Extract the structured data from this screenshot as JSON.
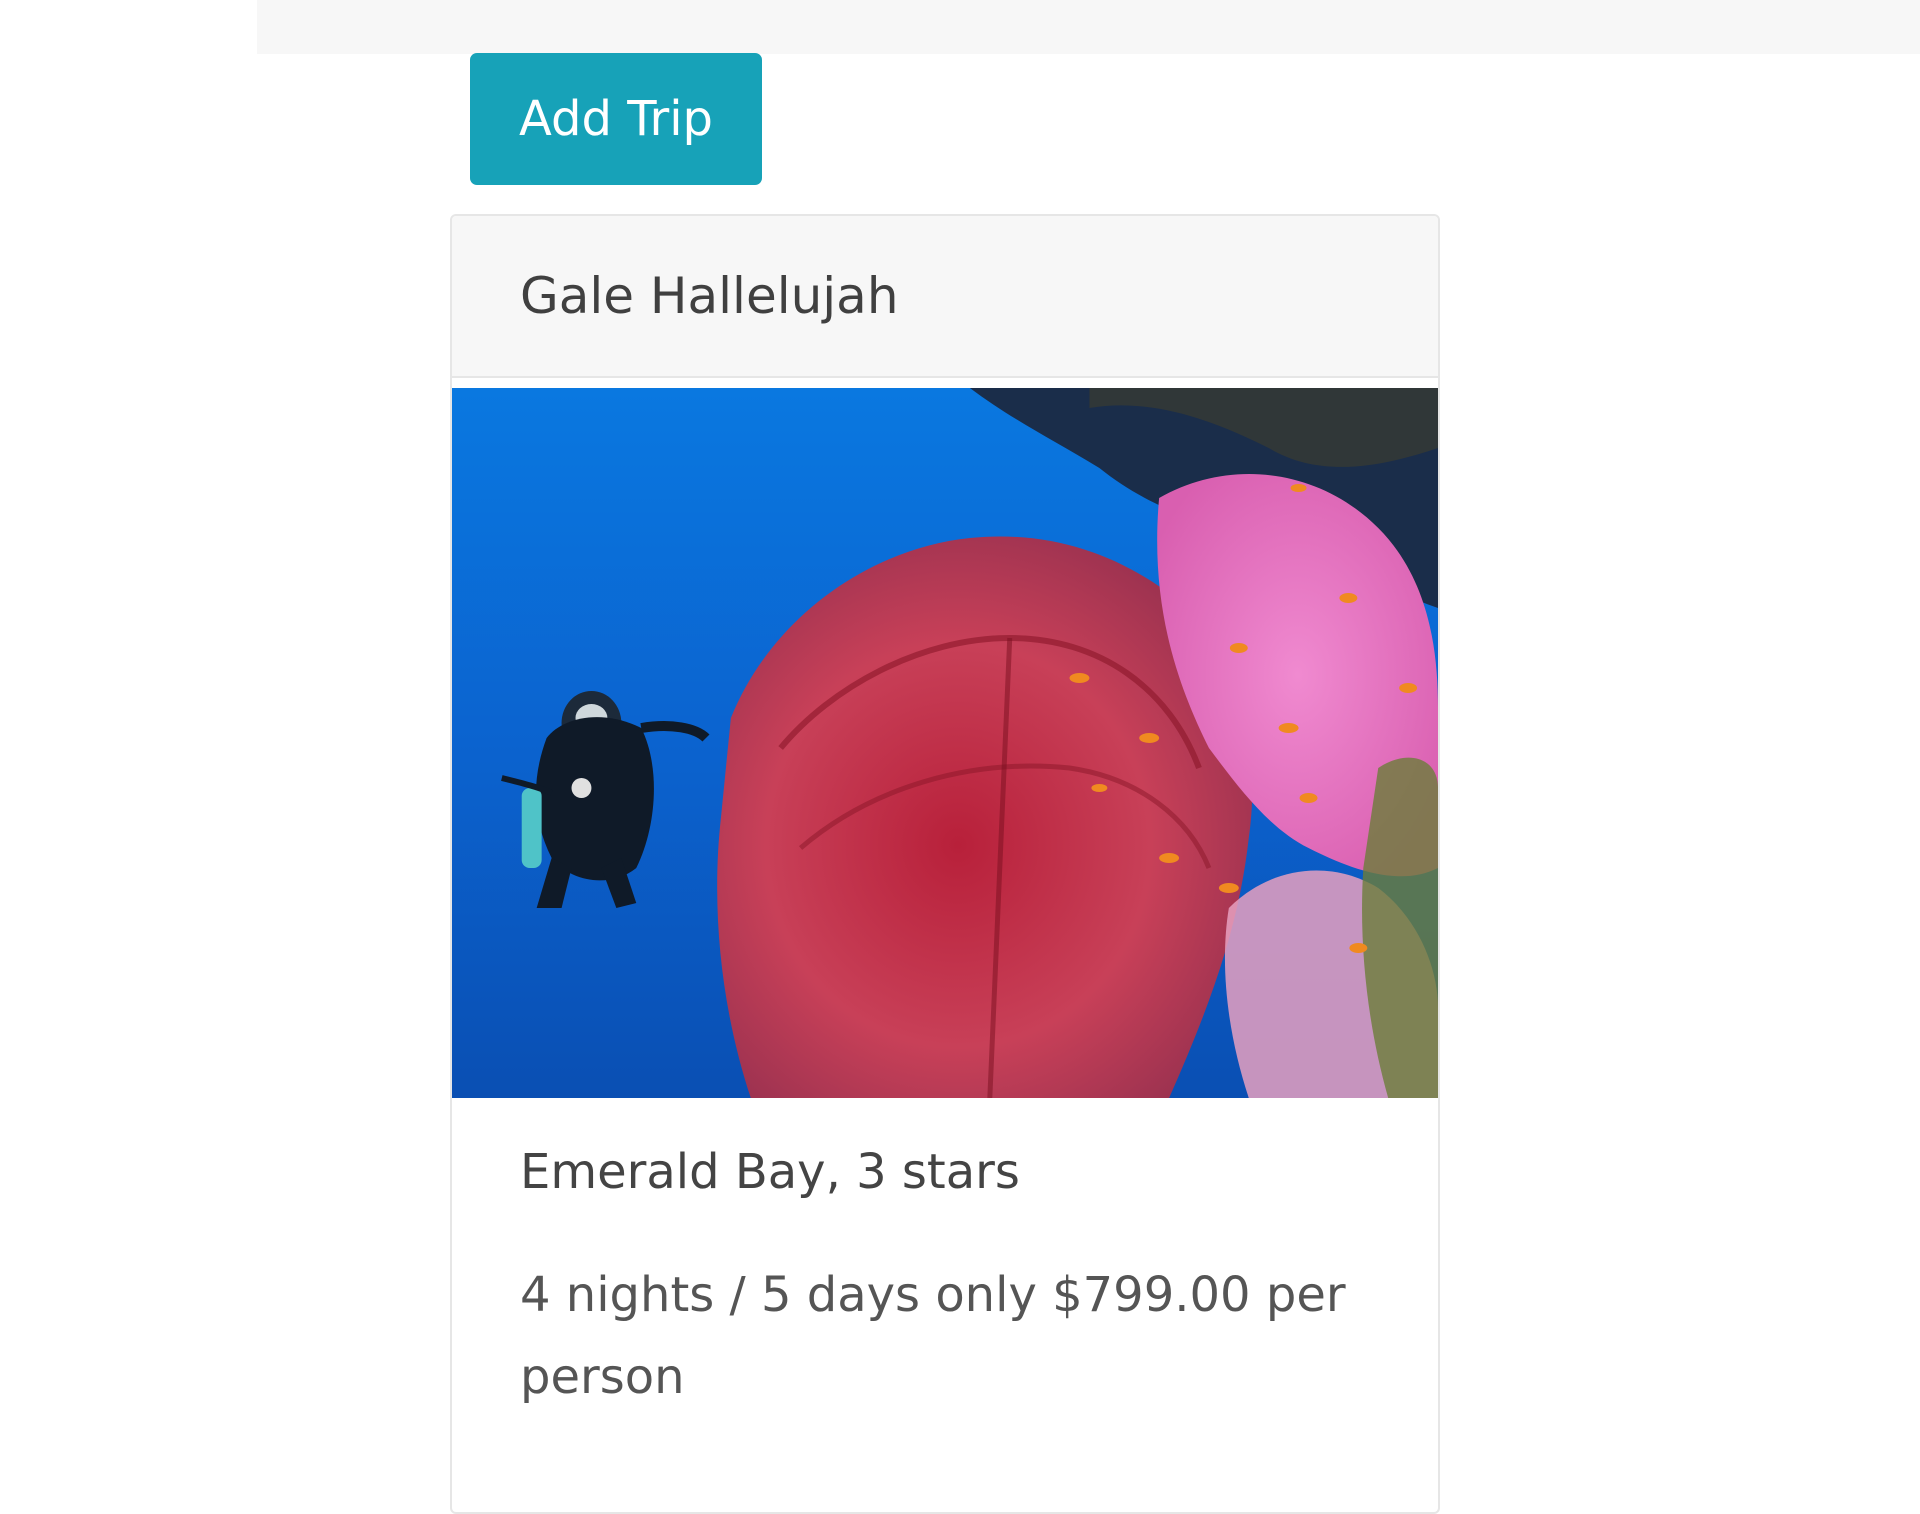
{
  "toolbar": {
    "add_trip_label": "Add Trip"
  },
  "trip_card": {
    "header": "Gale Hallelujah",
    "image_icon": "dive-photo",
    "title": "Emerald Bay, 3 stars",
    "description": "4 nights / 5 days only $799.00 per person"
  },
  "colors": {
    "accent": "#17a2b8",
    "card_header_bg": "#f7f7f7",
    "water": "#0b6fd6",
    "coral_red": "#c8324a",
    "coral_pink": "#e879c4"
  }
}
